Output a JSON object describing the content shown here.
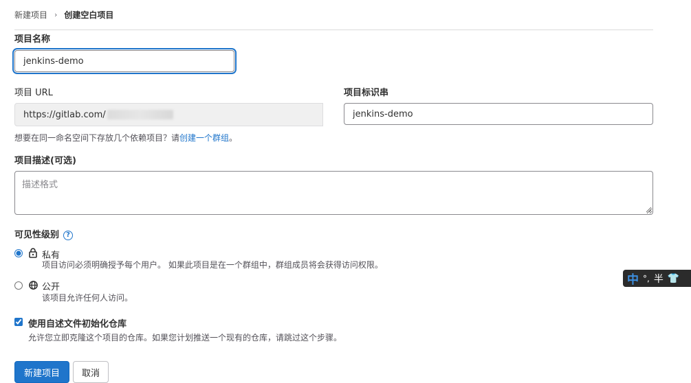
{
  "breadcrumb": {
    "parent": "新建项目",
    "separator": "›",
    "current": "创建空白项目"
  },
  "form": {
    "project_name": {
      "label": "项目名称",
      "value": "jenkins-demo"
    },
    "project_url": {
      "label": "项目 URL",
      "prefix": "https://gitlab.com/"
    },
    "project_slug": {
      "label": "项目标识串",
      "value": "jenkins-demo"
    },
    "hint": {
      "text": "想要在同一命名空间下存放几个依赖项目？请",
      "link": "创建一个群组",
      "suffix": "。"
    },
    "description": {
      "label": "项目描述(可选)",
      "placeholder": "描述格式"
    },
    "visibility": {
      "label": "可见性级别",
      "help_icon": "?",
      "options": [
        {
          "title": "私有",
          "icon": "lock-icon",
          "description": "项目访问必须明确授予每个用户。 如果此项目是在一个群组中，群组成员将会获得访问权限。",
          "selected": true
        },
        {
          "title": "公开",
          "icon": "globe-icon",
          "description": "该项目允许任何人访问。",
          "selected": false
        }
      ]
    },
    "init_readme": {
      "label": "使用自述文件初始化仓库",
      "description": "允许您立即克隆这个项目的仓库。如果您计划推送一个现有的仓库，请跳过这个步骤。",
      "checked": true
    }
  },
  "buttons": {
    "create": "新建项目",
    "cancel": "取消"
  },
  "ime": {
    "mode": "中",
    "punct": "°,",
    "width": "半",
    "skin": "👕"
  },
  "colors": {
    "primary": "#1f75cb",
    "text": "#303030",
    "muted": "#535158"
  }
}
